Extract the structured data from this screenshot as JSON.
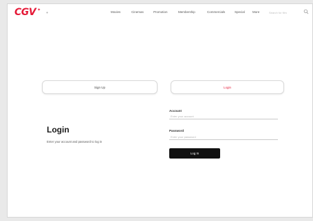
{
  "brand": {
    "logo_text": "CGV",
    "accent": "#e51937"
  },
  "header": {
    "nav": [
      "Movies",
      "Cinemas",
      "Promotion",
      "Membership",
      "Commercials",
      "Special",
      "More"
    ],
    "search_placeholder": "Search for film",
    "search_icon": "search-icon"
  },
  "tabs": {
    "signup_label": "Sign Up",
    "login_label": "Login",
    "active": "login"
  },
  "intro": {
    "title": "Login",
    "subtitle": "Enter your account and password to log in"
  },
  "form": {
    "id_label": "Account",
    "id_placeholder": "Enter your account",
    "id_value": "",
    "password_label": "Password",
    "password_placeholder": "Enter your password",
    "password_value": "",
    "submit_label": "Log In"
  }
}
